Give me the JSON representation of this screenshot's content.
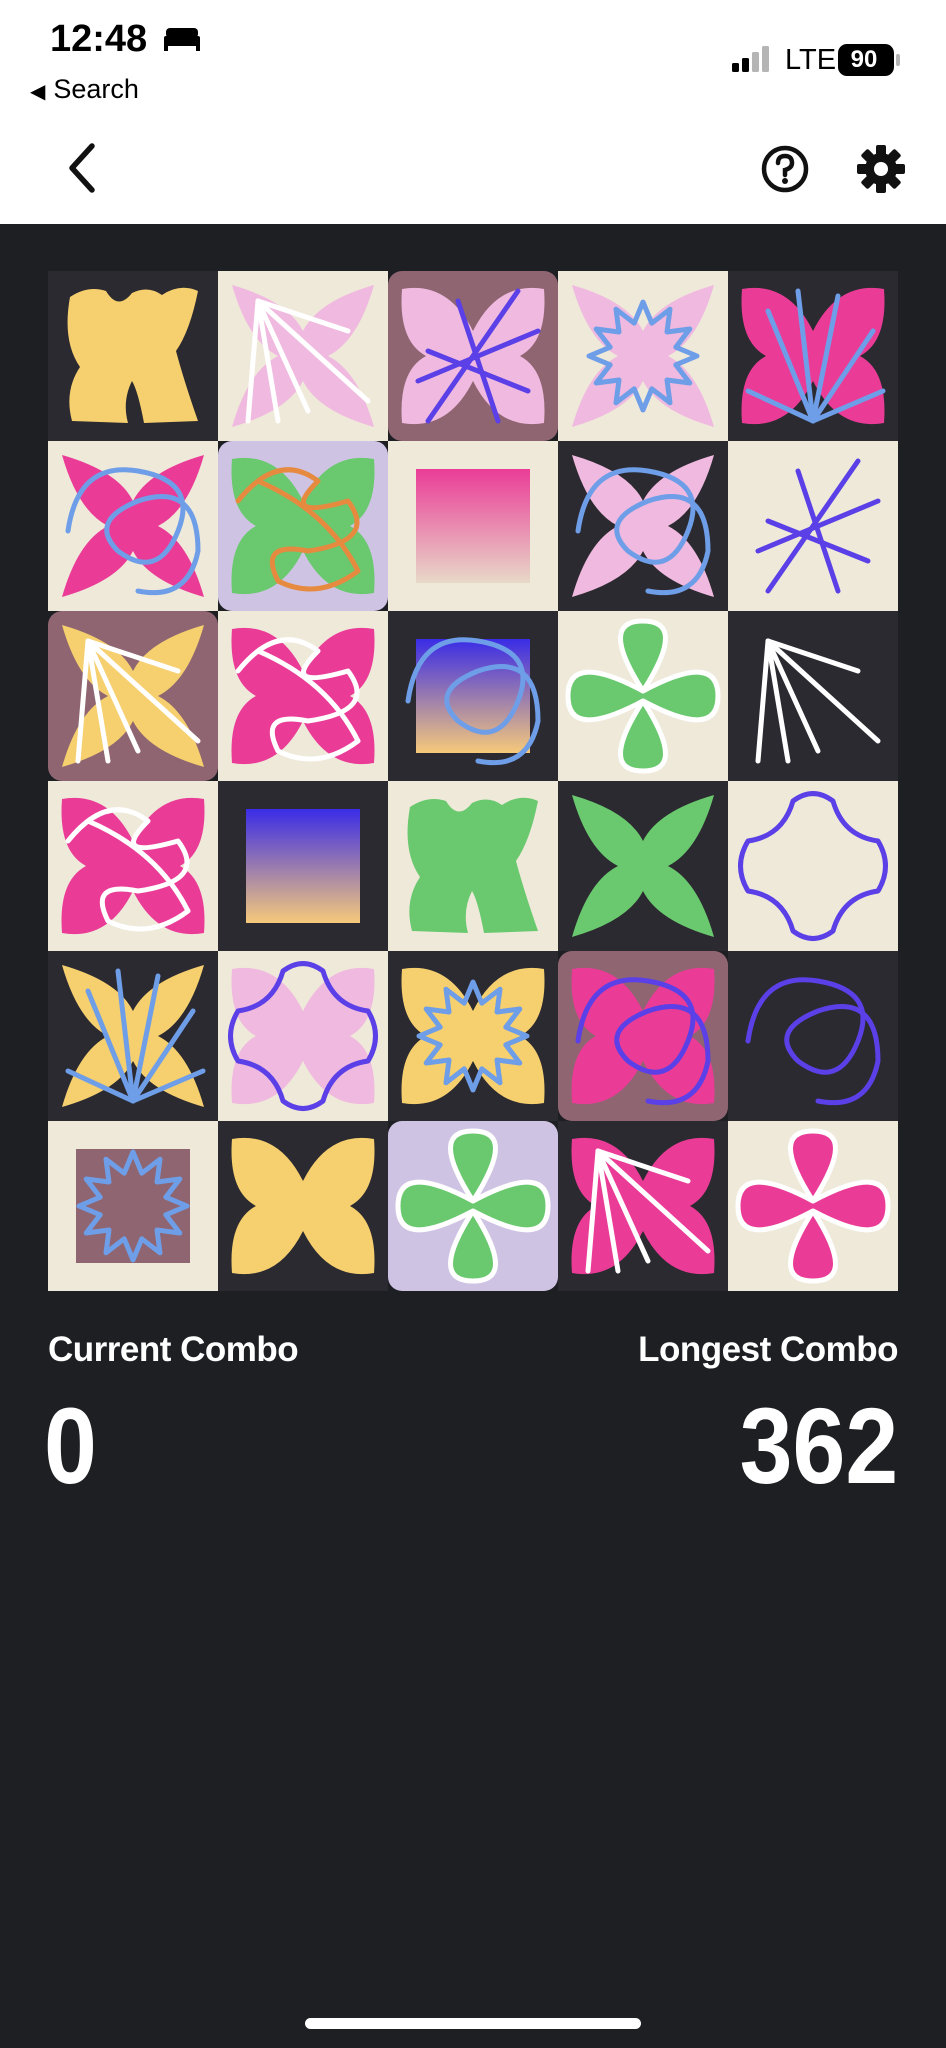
{
  "status_bar": {
    "time": "12:48",
    "back_app_label": "Search",
    "network": "LTE",
    "battery": "90"
  },
  "header": {
    "back_icon": "chevron-left-icon",
    "help_icon": "question-circle-icon",
    "settings_icon": "gear-icon"
  },
  "colors": {
    "background": "#1d1f23",
    "cream": "#efe9da",
    "dark": "#2b2a30",
    "mauve": "#8e6570",
    "lavender": "#cfc3e4",
    "yellow": "#f6cf6f",
    "pink": "#f0b9df",
    "magenta": "#ea3c97",
    "green": "#6ac96f",
    "blue": "#6f9ee8",
    "indigo": "#5a40e6",
    "white": "#ffffff"
  },
  "board": {
    "rows": 6,
    "cols": 5,
    "tiles": [
      {
        "bg": "dark",
        "shape": "blob",
        "fill": "yellow",
        "stroke": "none",
        "sc": "none"
      },
      {
        "bg": "cream",
        "shape": "x",
        "fill": "pink",
        "stroke": "burst",
        "sc": "white"
      },
      {
        "bg": "mauve",
        "shape": "bow",
        "fill": "pink",
        "stroke": "asterisk",
        "sc": "indigo"
      },
      {
        "bg": "cream",
        "shape": "x",
        "fill": "pink",
        "stroke": "star",
        "sc": "blue"
      },
      {
        "bg": "dark",
        "shape": "bow",
        "fill": "magenta",
        "stroke": "fan",
        "sc": "blue"
      },
      {
        "bg": "cream",
        "shape": "x",
        "fill": "magenta",
        "stroke": "loop",
        "sc": "blue"
      },
      {
        "bg": "lavender",
        "shape": "bow",
        "fill": "green",
        "stroke": "scribble",
        "sc": "orange"
      },
      {
        "bg": "cream",
        "shape": "square",
        "fill": "pinkgrad",
        "stroke": "none",
        "sc": "none"
      },
      {
        "bg": "dark",
        "shape": "x",
        "fill": "pink",
        "stroke": "loop",
        "sc": "blue"
      },
      {
        "bg": "cream",
        "shape": "none",
        "fill": "none",
        "stroke": "asterisk",
        "sc": "indigo"
      },
      {
        "bg": "mauve",
        "shape": "x",
        "fill": "yellow",
        "stroke": "burst",
        "sc": "white"
      },
      {
        "bg": "cream",
        "shape": "bow",
        "fill": "magenta",
        "stroke": "scribble",
        "sc": "white"
      },
      {
        "bg": "dark",
        "shape": "square",
        "fill": "indigograd",
        "stroke": "loop",
        "sc": "blue"
      },
      {
        "bg": "cream",
        "shape": "clover",
        "fill": "green",
        "stroke": "clover",
        "sc": "white"
      },
      {
        "bg": "dark",
        "shape": "none",
        "fill": "none",
        "stroke": "burst",
        "sc": "white"
      },
      {
        "bg": "cream",
        "shape": "bow",
        "fill": "magenta",
        "stroke": "scribble",
        "sc": "white"
      },
      {
        "bg": "dark",
        "shape": "square",
        "fill": "indigograd",
        "stroke": "none",
        "sc": "none"
      },
      {
        "bg": "cream",
        "shape": "blob",
        "fill": "green",
        "stroke": "none",
        "sc": "none"
      },
      {
        "bg": "dark",
        "shape": "x",
        "fill": "green",
        "stroke": "none",
        "sc": "none"
      },
      {
        "bg": "cream",
        "shape": "none",
        "fill": "none",
        "stroke": "cross",
        "sc": "indigo"
      },
      {
        "bg": "dark",
        "shape": "x",
        "fill": "yellow",
        "stroke": "fan",
        "sc": "blue"
      },
      {
        "bg": "cream",
        "shape": "bow",
        "fill": "pink",
        "stroke": "cross",
        "sc": "indigo"
      },
      {
        "bg": "dark",
        "shape": "bow",
        "fill": "yellow",
        "stroke": "star",
        "sc": "blue"
      },
      {
        "bg": "mauve",
        "shape": "bow",
        "fill": "magenta",
        "stroke": "loop",
        "sc": "indigo"
      },
      {
        "bg": "dark",
        "shape": "none",
        "fill": "none",
        "stroke": "loop",
        "sc": "indigo"
      },
      {
        "bg": "cream",
        "shape": "square",
        "fill": "mauvesq",
        "stroke": "star",
        "sc": "blue"
      },
      {
        "bg": "dark",
        "shape": "bow",
        "fill": "yellow",
        "stroke": "none",
        "sc": "none"
      },
      {
        "bg": "lavender",
        "shape": "clover",
        "fill": "green",
        "stroke": "clover",
        "sc": "white"
      },
      {
        "bg": "dark",
        "shape": "bow",
        "fill": "magenta",
        "stroke": "burst",
        "sc": "white"
      },
      {
        "bg": "cream",
        "shape": "clover",
        "fill": "magenta",
        "stroke": "clover",
        "sc": "white"
      }
    ]
  },
  "stats": {
    "current_label": "Current Combo",
    "current_value": "0",
    "longest_label": "Longest Combo",
    "longest_value": "362"
  }
}
